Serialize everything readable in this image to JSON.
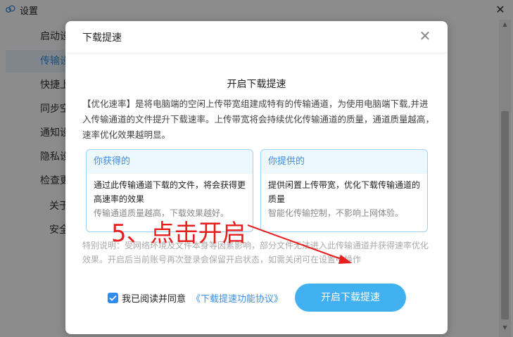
{
  "window": {
    "title": "设置",
    "close_glyph": "✕"
  },
  "sidebar": {
    "items": [
      {
        "label": "启动设置"
      },
      {
        "label": "传输设置"
      },
      {
        "label": "快捷上传"
      },
      {
        "label": "同步空间"
      },
      {
        "label": "通知设置"
      },
      {
        "label": "隐私设置"
      },
      {
        "label": "检查更新"
      },
      {
        "label": "关于"
      },
      {
        "label": "安全"
      }
    ]
  },
  "scrollbar": {
    "up_glyph": "▲",
    "down_glyph": "▼"
  },
  "modal": {
    "title": "下载提速",
    "close_glyph": "✕",
    "heading": "开启下载提速",
    "description": "【优化速率】是将电脑端的空闲上传带宽组建成特有的传输通道，为使用电脑端下载,并进入传输通道的文件提升下载速率。上传带宽将会持续优化传输通道的质量，通道质量越高，速率优化效果越明显。",
    "cards": [
      {
        "title": "你获得的",
        "body": "通过此传输通道下载的文件，将会获得更高速率的效果",
        "note": "传输通道质量越高，下载效果越好。"
      },
      {
        "title": "你提供的",
        "body": "提供闲置上传带宽，优化下载传输通道的质量",
        "note": "智能化传输控制，不影响上网体验。"
      }
    ],
    "note": "特别说明：受网络环境及文件本身等因素影响，部分文件无法进入此传输通道并获得速率优化效果。开启后当前账号再次登录会保留开启状态，如需关闭可在设置中操作",
    "agree_text": "我已阅读并同意",
    "agree_link": "《下载提速功能协议》",
    "agree_checked": true,
    "primary_button": "开启下载提速"
  },
  "annotation": {
    "text": "5、点击开启",
    "color": "#e81d1d"
  },
  "colors": {
    "accent": "#3a8ee6",
    "button": "#41b0f0",
    "card_border": "#9cd0f5"
  }
}
